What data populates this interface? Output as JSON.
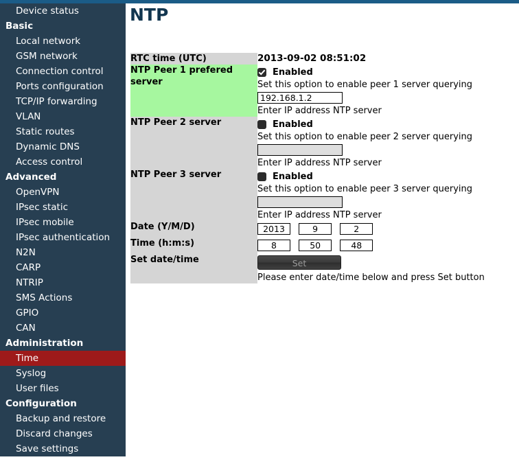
{
  "sidebar": {
    "items": [
      {
        "label": "Device status",
        "type": "link",
        "active": false
      },
      {
        "label": "Basic",
        "type": "section",
        "active": false
      },
      {
        "label": "Local network",
        "type": "link",
        "active": false
      },
      {
        "label": "GSM network",
        "type": "link",
        "active": false
      },
      {
        "label": "Connection control",
        "type": "link",
        "active": false
      },
      {
        "label": "Ports configuration",
        "type": "link",
        "active": false
      },
      {
        "label": "TCP/IP forwarding",
        "type": "link",
        "active": false
      },
      {
        "label": "VLAN",
        "type": "link",
        "active": false
      },
      {
        "label": "Static routes",
        "type": "link",
        "active": false
      },
      {
        "label": "Dynamic DNS",
        "type": "link",
        "active": false
      },
      {
        "label": "Access control",
        "type": "link",
        "active": false
      },
      {
        "label": "Advanced",
        "type": "section",
        "active": false
      },
      {
        "label": "OpenVPN",
        "type": "link",
        "active": false
      },
      {
        "label": "IPsec static",
        "type": "link",
        "active": false
      },
      {
        "label": "IPsec mobile",
        "type": "link",
        "active": false
      },
      {
        "label": "IPsec authentication",
        "type": "link",
        "active": false
      },
      {
        "label": "N2N",
        "type": "link",
        "active": false
      },
      {
        "label": "CARP",
        "type": "link",
        "active": false
      },
      {
        "label": "NTRIP",
        "type": "link",
        "active": false
      },
      {
        "label": "SMS Actions",
        "type": "link",
        "active": false
      },
      {
        "label": "GPIO",
        "type": "link",
        "active": false
      },
      {
        "label": "CAN",
        "type": "link",
        "active": false
      },
      {
        "label": "Administration",
        "type": "section",
        "active": false
      },
      {
        "label": "Time",
        "type": "link",
        "active": true
      },
      {
        "label": "Syslog",
        "type": "link",
        "active": false
      },
      {
        "label": "User files",
        "type": "link",
        "active": false
      },
      {
        "label": "Configuration",
        "type": "section",
        "active": false
      },
      {
        "label": "Backup and restore",
        "type": "link",
        "active": false
      },
      {
        "label": "Discard changes",
        "type": "link",
        "active": false
      },
      {
        "label": "Save settings",
        "type": "link",
        "active": false
      }
    ]
  },
  "page": {
    "title": "NTP"
  },
  "rtc": {
    "label": "RTC time (UTC)",
    "value": "2013-09-02 08:51:02"
  },
  "peer1": {
    "label": "NTP Peer 1 prefered server",
    "enabled_label": "Enabled",
    "enabled": true,
    "enable_hint": "Set this option to enable peer 1 server querying",
    "ip_value": "192.168.1.2",
    "ip_hint": "Enter IP address NTP server"
  },
  "peer2": {
    "label": "NTP Peer 2 server",
    "enabled_label": "Enabled",
    "enabled": false,
    "enable_hint": "Set this option to enable peer 2 server querying",
    "ip_value": "",
    "ip_hint": "Enter IP address NTP server"
  },
  "peer3": {
    "label": "NTP Peer 3 server",
    "enabled_label": "Enabled",
    "enabled": false,
    "enable_hint": "Set this option to enable peer 3 server querying",
    "ip_value": "",
    "ip_hint": "Enter IP address NTP server"
  },
  "date": {
    "label": "Date (Y/M/D)",
    "year": "2013",
    "month": "9",
    "day": "2"
  },
  "time": {
    "label": "Time (h:m:s)",
    "hour": "8",
    "minute": "50",
    "second": "48"
  },
  "set_datetime": {
    "label": "Set date/time",
    "button_label": "Set",
    "hint": "Please enter date/time below and press Set button"
  },
  "colors": {
    "top_bar": "#1b5c87",
    "sidebar_bg": "#273f52",
    "sidebar_active": "#9e1a1a",
    "title": "#12364f",
    "row_highlight_green": "#a6f79f",
    "row_label_grey": "#d5d5d5"
  }
}
